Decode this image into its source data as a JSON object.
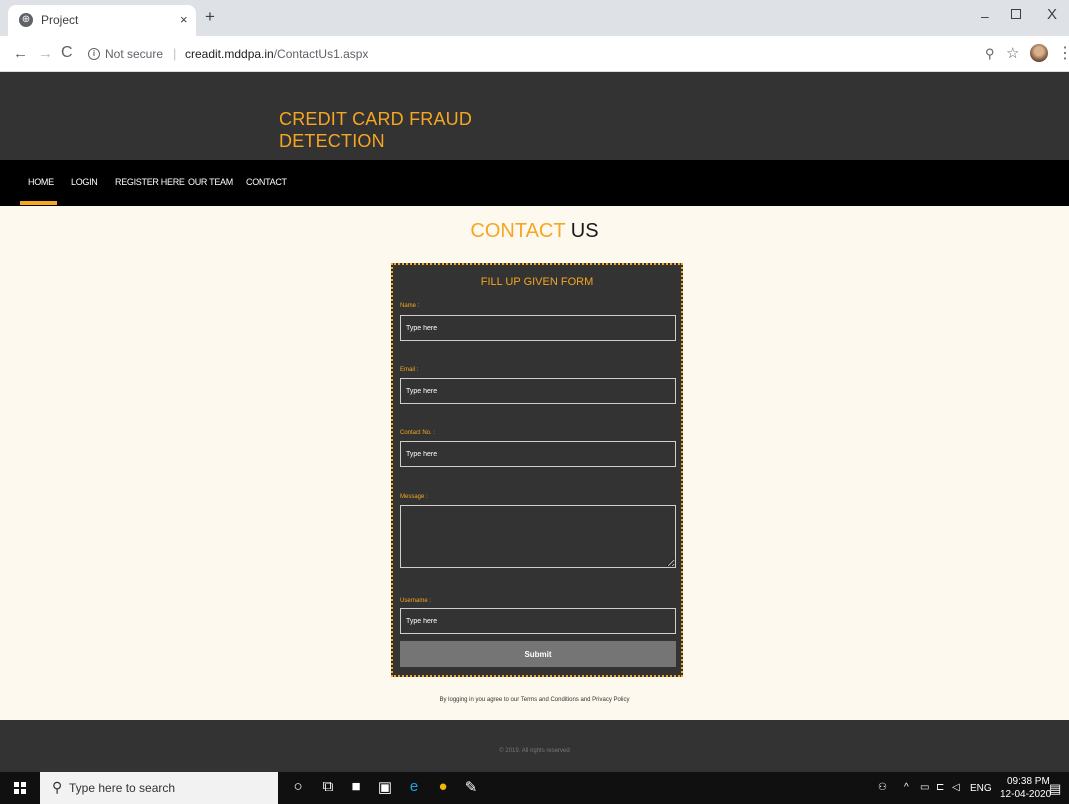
{
  "browser": {
    "tab_title": "Project",
    "tab_close": "×",
    "new_tab": "+",
    "not_secure": "Not secure",
    "url_host": "creadit.mddpa.in",
    "url_path": "/ContactUs1.aspx",
    "window_min": "–",
    "window_close": "X"
  },
  "site": {
    "title": "CREDIT CARD FRAUD DETECTION",
    "nav": [
      "HOME",
      "LOGIN",
      "REGISTER HERE",
      "OUR TEAM",
      "CONTACT"
    ],
    "active_nav": "HOME",
    "heading_part1": "CONTACT",
    "heading_part2": "US",
    "form": {
      "title": "FILL UP GIVEN FORM",
      "name_label": "Name :",
      "name_placeholder": "Type here",
      "email_label": "Email :",
      "email_placeholder": "Type here",
      "contact_label": "Contact No. :",
      "contact_placeholder": "Type here",
      "message_label": "Message :",
      "username_label": "Username :",
      "username_placeholder": "Type here",
      "submit_label": "Submit"
    },
    "agree_text": "By logging in you agree to our Terms and Conditions and Privacy Policy",
    "footer_text": "© 2019. All rights reserved"
  },
  "taskbar": {
    "search_placeholder": "Type here to search",
    "lang": "ENG",
    "time": "09:38 PM",
    "date": "12-04-2020"
  },
  "colors": {
    "accent": "#f5a623",
    "header_bg": "#333333",
    "nav_bg": "#000000",
    "page_bg": "#fef9ef"
  }
}
